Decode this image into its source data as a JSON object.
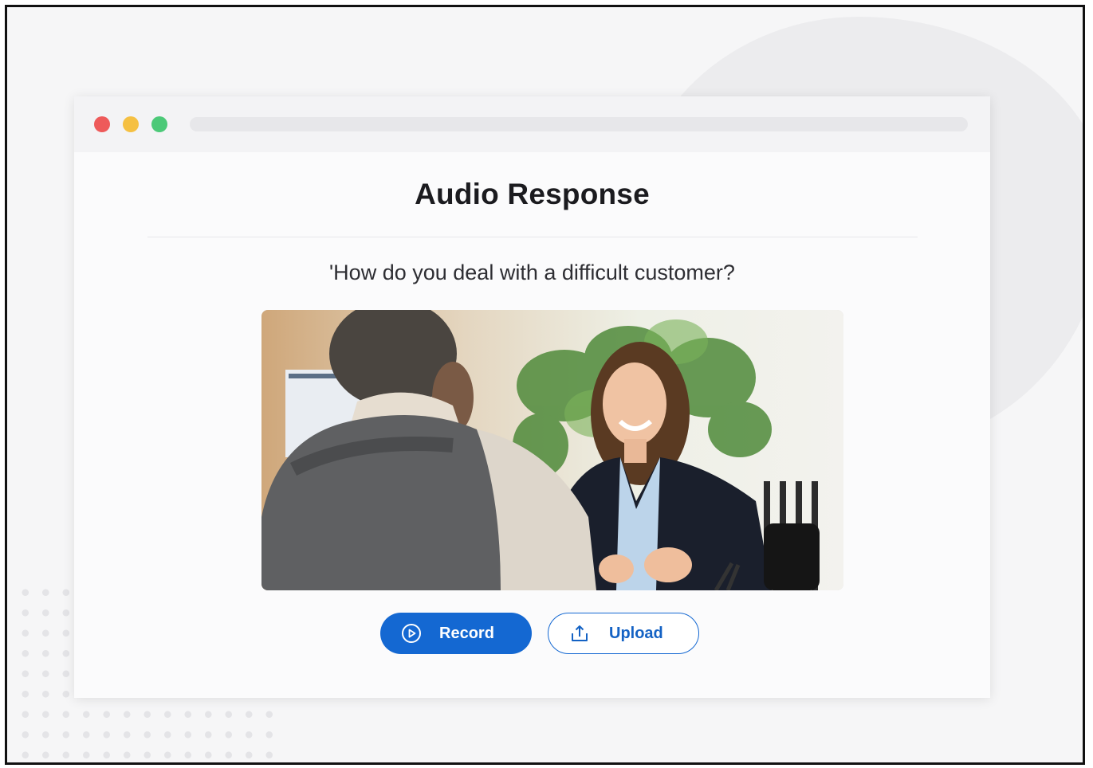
{
  "window": {
    "traffic_lights": [
      "close",
      "minimize",
      "maximize"
    ]
  },
  "page": {
    "title": "Audio Response",
    "question": "'How do you deal with a difficult customer?"
  },
  "actions": {
    "record_label": "Record",
    "record_icon": "play-circle-icon",
    "upload_label": "Upload",
    "upload_icon": "upload-icon"
  },
  "colors": {
    "accent": "#1468d2",
    "close": "#ee5a5a",
    "minimize": "#f5c042",
    "maximize": "#4cc978"
  }
}
